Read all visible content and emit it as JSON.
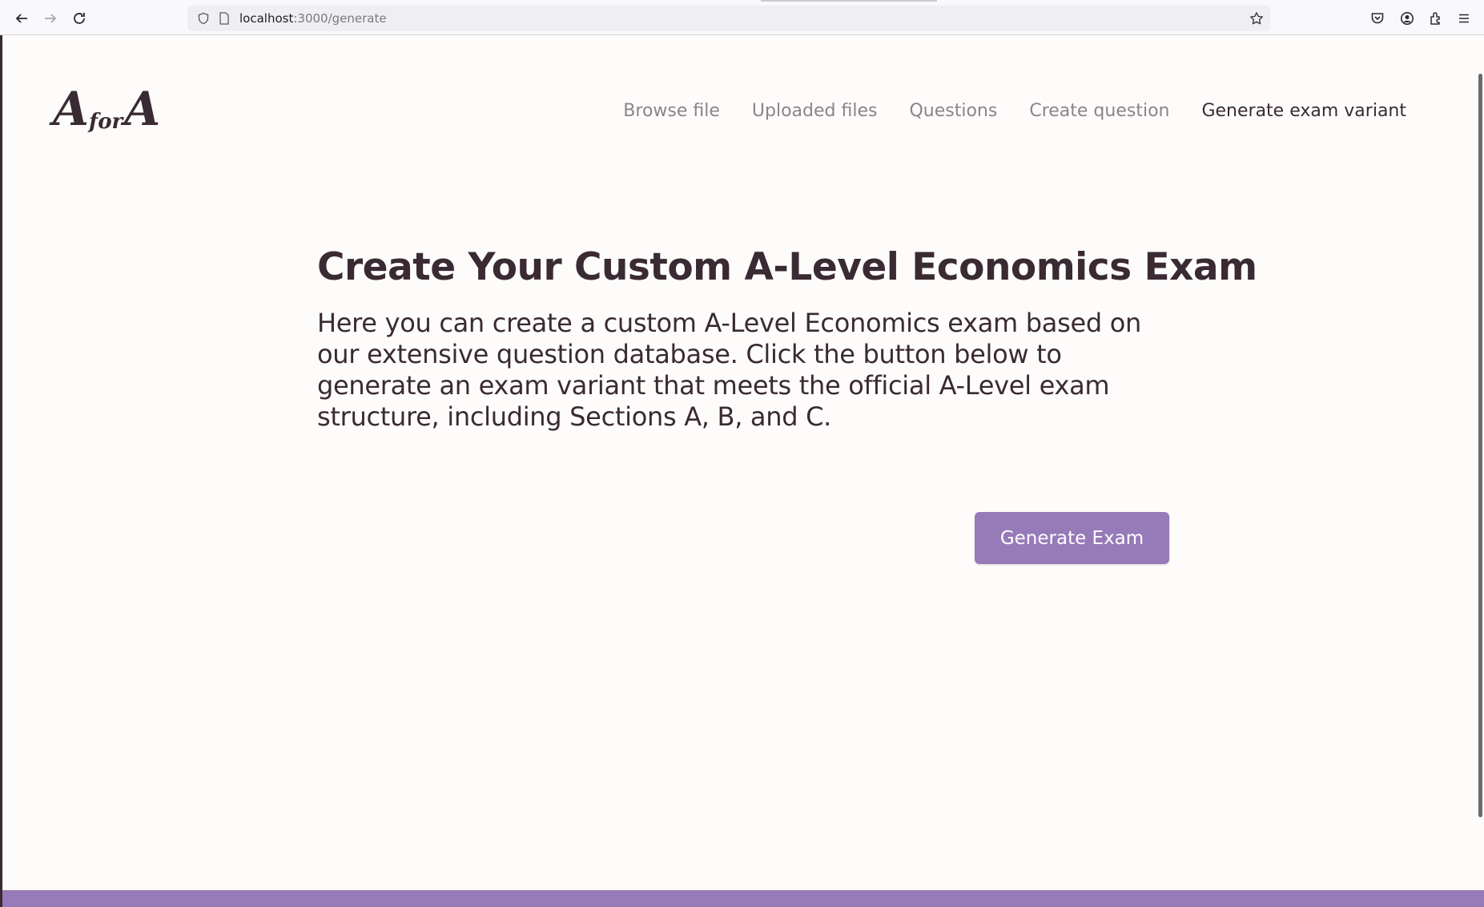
{
  "browser": {
    "url_host": "localhost",
    "url_path": ":3000/generate",
    "icons": [
      "back-arrow-icon",
      "forward-arrow-icon",
      "reload-icon",
      "shield-icon",
      "page-icon",
      "star-icon",
      "pocket-icon",
      "account-icon",
      "extensions-icon",
      "menu-icon"
    ]
  },
  "site": {
    "logo": {
      "first": "A",
      "middle": "for",
      "last": "A"
    },
    "nav": [
      {
        "label": "Browse file",
        "active": false
      },
      {
        "label": "Uploaded files",
        "active": false
      },
      {
        "label": "Questions",
        "active": false
      },
      {
        "label": "Create question",
        "active": false
      },
      {
        "label": "Generate exam variant",
        "active": true
      }
    ]
  },
  "main": {
    "title": "Create Your Custom A-Level Economics Exam",
    "intro": "Here you can create a custom A-Level Economics exam based on our extensive question database. Click the button below to generate an exam variant that meets the official A-Level exam structure, including Sections A, B, and C.",
    "button_label": "Generate Exam"
  },
  "colors": {
    "accent": "#977ab8",
    "text": "#3a2a33",
    "nav_inactive": "#8a8488",
    "background": "#fdfcfa"
  }
}
